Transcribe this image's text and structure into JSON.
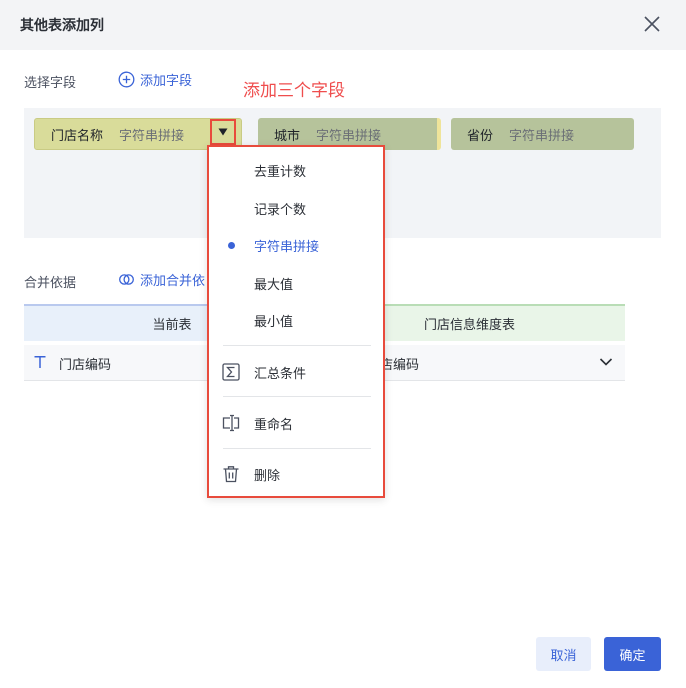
{
  "dialog": {
    "title": "其他表添加列"
  },
  "fields_section": {
    "label": "选择字段",
    "add_label": "添加字段"
  },
  "annotation": "添加三个字段",
  "chips": [
    {
      "name": "门店名称",
      "agg": "字符串拼接"
    },
    {
      "name": "城市",
      "agg": "字符串拼接"
    },
    {
      "name": "省份",
      "agg": "字符串拼接"
    }
  ],
  "menu": {
    "items": [
      {
        "label": "去重计数",
        "selected": false
      },
      {
        "label": "记录个数",
        "selected": false
      },
      {
        "label": "字符串拼接",
        "selected": true
      },
      {
        "label": "最大值",
        "selected": false
      },
      {
        "label": "最小值",
        "selected": false
      }
    ],
    "actions": [
      {
        "label": "汇总条件",
        "icon": "sigma-icon"
      },
      {
        "label": "重命名",
        "icon": "rename-icon"
      },
      {
        "label": "删除",
        "icon": "trash-icon"
      }
    ]
  },
  "merge_section": {
    "label": "合并依据",
    "add_label": "添加合并依"
  },
  "table": {
    "headers": [
      "当前表",
      "门店信息维度表"
    ],
    "row": {
      "left_icon": "text-type-icon",
      "left": "门店编码",
      "right": "店编码"
    }
  },
  "buttons": {
    "cancel": "取消",
    "ok": "确定"
  },
  "colors": {
    "accent": "#3a63d7",
    "highlight": "#e84b3c",
    "chip_primary": "#d9dc9a",
    "chip_secondary": "#b6c39b"
  }
}
